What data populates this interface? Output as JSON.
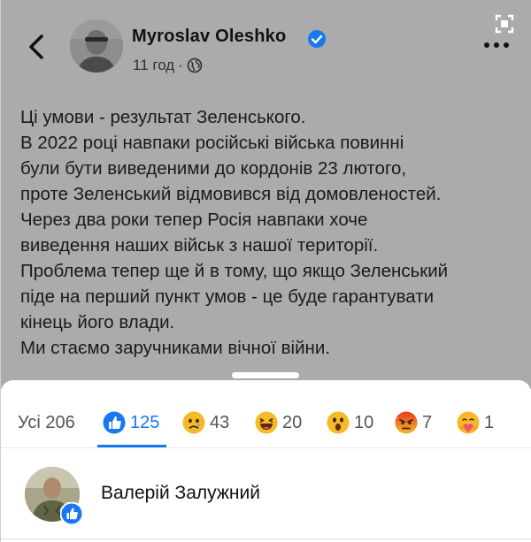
{
  "header": {
    "author_name": "Myroslav Oleshko",
    "post_time": "11 год",
    "separator": "·",
    "verified": true,
    "audience_icon": "globe-icon"
  },
  "post": {
    "lines": [
      "Ці умови - результат Зеленського.",
      "В 2022 році навпаки російські війська повинні",
      "були бути виведеними до кордонів 23 лютого,",
      "проте Зеленський відмовився від домовленостей.",
      "Через два роки тепер Росія навпаки хоче",
      "виведення наших військ з нашої території.",
      "Проблема тепер ще й в тому, що якщо Зеленський",
      "піде на перший пункт умов - це буде гарантувати",
      "кінець його влади.",
      "Ми стаємо заручниками вічної війни."
    ]
  },
  "reactions": {
    "all_label": "Усі 206",
    "items": [
      {
        "icon": "like-icon",
        "count": "125"
      },
      {
        "icon": "sad-icon",
        "count": "43"
      },
      {
        "icon": "haha-icon",
        "count": "20"
      },
      {
        "icon": "wow-icon",
        "count": "10"
      },
      {
        "icon": "angry-icon",
        "count": "7"
      },
      {
        "icon": "care-icon",
        "count": "1"
      }
    ]
  },
  "reactors": [
    {
      "name": "Валерій Залужний",
      "reaction": "like-icon"
    }
  ],
  "colors": {
    "accent": "#1877f2",
    "dim_overlay": "#ababab",
    "reaction_yellow": "#f7b928",
    "angry_red": "#e9710f"
  }
}
